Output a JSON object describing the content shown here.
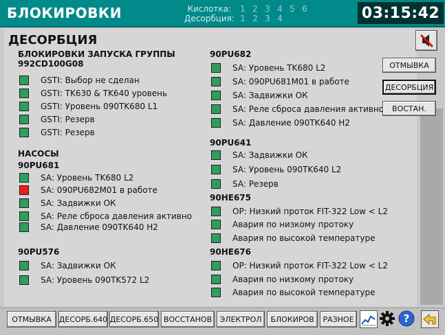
{
  "header": {
    "title": "БЛОКИРОВКИ",
    "clock": "03:15:42",
    "phases": [
      {
        "label": "Кислотка:",
        "numbers": [
          "1",
          "2",
          "3",
          "4",
          "5",
          "6"
        ]
      },
      {
        "label": "Десорбция:",
        "numbers": [
          "1",
          "2",
          "3",
          "4"
        ]
      }
    ]
  },
  "page_title": "ДЕСОРБЦИЯ",
  "left": {
    "startup_title": "БЛОКИРОВКИ ЗАПУСКА ГРУППЫ",
    "group_id": "992CD100G08",
    "startup_items": [
      {
        "label": "GSTI: Выбор не сделан",
        "state": "green"
      },
      {
        "label": "GSTI: TK630 & TK640 уровень",
        "state": "green"
      },
      {
        "label": "GSTI: Уровень 090TK680 L1",
        "state": "green"
      },
      {
        "label": "GSTI: Резерв",
        "state": "green"
      },
      {
        "label": "GSTI: Резерв",
        "state": "green"
      }
    ],
    "pumps_title": "НАСОСЫ",
    "pu681_title": "90PU681",
    "pu681_items": [
      {
        "label": "SA: Уровень TK680 L2",
        "state": "green"
      },
      {
        "label": "SA: 090PU682M01 в работе",
        "state": "red"
      },
      {
        "label": "SA: Задвижки ОК",
        "state": "green"
      },
      {
        "label": "SA: Реле сброса давления активно",
        "state": "green"
      },
      {
        "label": "SA: Давление  090TK640 H2",
        "state": "green"
      }
    ],
    "pu576_title": "90PU576",
    "pu576_items": [
      {
        "label": "SA: Задвижки ОК",
        "state": "green"
      },
      {
        "label": "SA: Уровень 090TK572 L2",
        "state": "green"
      }
    ]
  },
  "right": {
    "pu682_title": "90PU682",
    "pu682_items": [
      {
        "label": "SA: Уровень TK680 L2",
        "state": "green"
      },
      {
        "label": "SA: 090PU681M01 в работе",
        "state": "green"
      },
      {
        "label": "SA: Задвижки ОК",
        "state": "green"
      },
      {
        "label": "SA: Реле сброса давления активно",
        "state": "green"
      },
      {
        "label": "SA: Давление  090TK640 H2",
        "state": "green"
      }
    ],
    "pu641_title": "90PU641",
    "pu641_items": [
      {
        "label": "SA: Задвижки ОК",
        "state": "green"
      },
      {
        "label": "SA: Уровень 090TK640 L2",
        "state": "green"
      },
      {
        "label": "SA: Резерв",
        "state": "green"
      }
    ],
    "he675_title": "90HE675",
    "he675_items": [
      {
        "label": "OP: Низкий проток  FIT-322 Low < L2",
        "state": "green"
      },
      {
        "label": "Авария по низкому протоку",
        "state": "green"
      },
      {
        "label": "Авария по высокой температуре",
        "state": "green"
      }
    ],
    "he676_title": "90HE676",
    "he676_items": [
      {
        "label": "OP: Низкий проток  FIT-322 Low < L2",
        "state": "green"
      },
      {
        "label": "Авария по низкому протоку",
        "state": "green"
      },
      {
        "label": "Авария по высокой температуре",
        "state": "green"
      }
    ]
  },
  "side_buttons": {
    "wash": "ОТМЫВКА",
    "desorption": "ДЕСОРБЦИЯ",
    "restore": "ВОСТАН."
  },
  "bottom_nav": [
    "ОТМЫВКА",
    "ДЕСОРБ.640",
    "ДЕСОРБ.650",
    "ВОССТАНОВ",
    "ЭЛЕКТРОЛ",
    "БЛОКИРОВ",
    "РАЗНОЕ"
  ],
  "icons": {
    "mute": "speaker-muted-icon",
    "trend": "trend-chart-icon",
    "settings": "gear-icon",
    "help": "help-icon",
    "back": "back-arrow-icon"
  },
  "colors": {
    "titlebar": "#008a8a",
    "indicator_ok": "#2f9e5c",
    "indicator_alarm": "#ee1c1c"
  }
}
